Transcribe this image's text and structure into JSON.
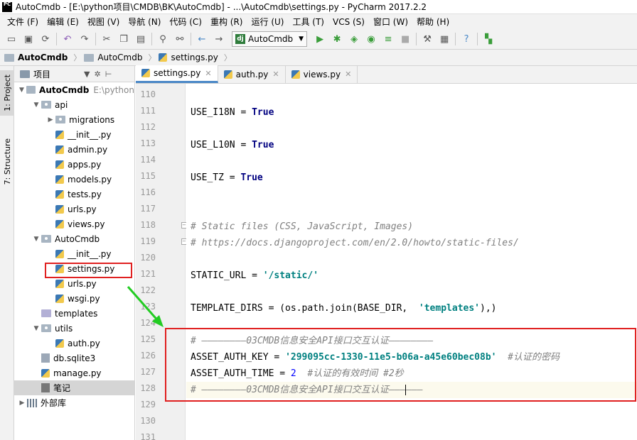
{
  "window": {
    "logo": "PC",
    "title": "AutoCmdb - [E:\\python项目\\CMDB\\BK\\AutoCmdb] - ...\\AutoCmdb\\settings.py - PyCharm 2017.2.2"
  },
  "menubar": [
    {
      "name": "file",
      "label": "文件 (F)"
    },
    {
      "name": "edit",
      "label": "编辑 (E)"
    },
    {
      "name": "view",
      "label": "视图 (V)"
    },
    {
      "name": "navigate",
      "label": "导航 (N)"
    },
    {
      "name": "code",
      "label": "代码 (C)"
    },
    {
      "name": "refactor",
      "label": "重构 (R)"
    },
    {
      "name": "run",
      "label": "运行 (U)"
    },
    {
      "name": "tools",
      "label": "工具 (T)"
    },
    {
      "name": "vcs",
      "label": "VCS (S)"
    },
    {
      "name": "window",
      "label": "窗口 (W)"
    },
    {
      "name": "help",
      "label": "帮助 (H)"
    }
  ],
  "toolbar": {
    "run_config": "AutoCmdb",
    "django_badge": "dj"
  },
  "breadcrumbs": [
    "AutoCmdb",
    "AutoCmdb",
    "settings.py"
  ],
  "side_tabs": {
    "project": "1: Project",
    "structure": "7: Structure"
  },
  "project_panel": {
    "header": "项目",
    "tree": [
      {
        "label": "AutoCmdb",
        "extra": "E:\\python",
        "type": "root",
        "level": 0,
        "expanded": true
      },
      {
        "label": "api",
        "type": "package",
        "level": 1,
        "expanded": true
      },
      {
        "label": "migrations",
        "type": "package",
        "level": 2,
        "expanded": false
      },
      {
        "label": "__init__.py",
        "type": "py",
        "level": 2
      },
      {
        "label": "admin.py",
        "type": "py",
        "level": 2
      },
      {
        "label": "apps.py",
        "type": "py",
        "level": 2
      },
      {
        "label": "models.py",
        "type": "py",
        "level": 2
      },
      {
        "label": "tests.py",
        "type": "py",
        "level": 2
      },
      {
        "label": "urls.py",
        "type": "py",
        "level": 2
      },
      {
        "label": "views.py",
        "type": "py",
        "level": 2
      },
      {
        "label": "AutoCmdb",
        "type": "package",
        "level": 1,
        "expanded": true
      },
      {
        "label": "__init__.py",
        "type": "py",
        "level": 2
      },
      {
        "label": "settings.py",
        "type": "py",
        "level": 2
      },
      {
        "label": "urls.py",
        "type": "py",
        "level": 2
      },
      {
        "label": "wsgi.py",
        "type": "py",
        "level": 2
      },
      {
        "label": "templates",
        "type": "folder",
        "level": 1
      },
      {
        "label": "utils",
        "type": "package",
        "level": 1,
        "expanded": true
      },
      {
        "label": "auth.py",
        "type": "py",
        "level": 2
      },
      {
        "label": "db.sqlite3",
        "type": "db",
        "level": 1
      },
      {
        "label": "manage.py",
        "type": "py",
        "level": 1
      },
      {
        "label": "笔记",
        "type": "note",
        "level": 1,
        "selected": true
      },
      {
        "label": "外部库",
        "type": "lib",
        "level": 0,
        "expanded": false
      }
    ]
  },
  "editor_tabs": [
    {
      "label": "settings.py",
      "active": true
    },
    {
      "label": "auth.py",
      "active": false
    },
    {
      "label": "views.py",
      "active": false
    }
  ],
  "editor": {
    "lines": [
      {
        "no": "110",
        "segs": []
      },
      {
        "no": "111",
        "segs": [
          {
            "t": "USE_I18N = ",
            "c": ""
          },
          {
            "t": "True",
            "c": "kw"
          }
        ]
      },
      {
        "no": "112",
        "segs": []
      },
      {
        "no": "113",
        "segs": [
          {
            "t": "USE_L10N = ",
            "c": ""
          },
          {
            "t": "True",
            "c": "kw"
          }
        ]
      },
      {
        "no": "114",
        "segs": []
      },
      {
        "no": "115",
        "segs": [
          {
            "t": "USE_TZ = ",
            "c": ""
          },
          {
            "t": "True",
            "c": "kw"
          }
        ]
      },
      {
        "no": "116",
        "segs": []
      },
      {
        "no": "117",
        "segs": []
      },
      {
        "no": "118",
        "segs": [
          {
            "t": "# Static files (CSS, JavaScript, Images)",
            "c": "cmt"
          }
        ],
        "fold": true
      },
      {
        "no": "119",
        "segs": [
          {
            "t": "# https://docs.djangoproject.com/en/2.0/howto/static-files/",
            "c": "cmt"
          }
        ],
        "fold": true
      },
      {
        "no": "120",
        "segs": []
      },
      {
        "no": "121",
        "segs": [
          {
            "t": "STATIC_URL = ",
            "c": ""
          },
          {
            "t": "'/static/'",
            "c": "str"
          }
        ]
      },
      {
        "no": "122",
        "segs": []
      },
      {
        "no": "123",
        "segs": [
          {
            "t": "TEMPLATE_DIRS = (os.path.join(BASE_DIR,  ",
            "c": ""
          },
          {
            "t": "'templates'",
            "c": "str"
          },
          {
            "t": "),)",
            "c": ""
          }
        ]
      },
      {
        "no": "124",
        "segs": []
      },
      {
        "no": "125",
        "segs": [
          {
            "t": "# ————————03CMDB信息安全API接口交互认证————————",
            "c": "cmt"
          }
        ]
      },
      {
        "no": "126",
        "segs": [
          {
            "t": "ASSET_AUTH_KEY = ",
            "c": ""
          },
          {
            "t": "'299095cc-1330-11e5-b06a-a45e60bec08b'",
            "c": "str"
          },
          {
            "t": "  #认证的密码",
            "c": "cmt"
          }
        ]
      },
      {
        "no": "127",
        "segs": [
          {
            "t": "ASSET_AUTH_TIME = ",
            "c": ""
          },
          {
            "t": "2",
            "c": "num"
          },
          {
            "t": "  #认证的有效时间 #2秒",
            "c": "cmt"
          }
        ]
      },
      {
        "no": "128",
        "segs": [
          {
            "t": "# ————————03CMDB信息安全API接口交互认证———",
            "c": "cmt"
          },
          {
            "t": "|",
            "c": "cursor"
          },
          {
            "t": "———",
            "c": "cmt"
          }
        ],
        "current": true
      },
      {
        "no": "129",
        "segs": []
      },
      {
        "no": "130",
        "segs": []
      },
      {
        "no": "131",
        "segs": []
      }
    ]
  },
  "colors": {
    "annotation_red": "#e02020",
    "annotation_green": "#22cc22",
    "tab_underline": "#4a88c7"
  }
}
